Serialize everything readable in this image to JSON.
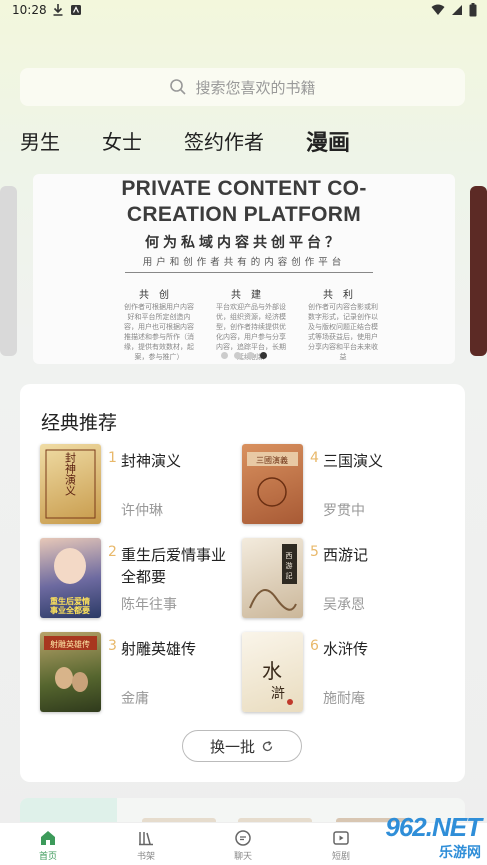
{
  "status_bar": {
    "time": "10:28"
  },
  "search": {
    "placeholder": "搜索您喜欢的书籍"
  },
  "tabs": [
    {
      "label": "男生",
      "active": false
    },
    {
      "label": "女士",
      "active": false
    },
    {
      "label": "签约作者",
      "active": false
    },
    {
      "label": "漫画",
      "active": true
    }
  ],
  "banner": {
    "title_line1": "PRIVATE CONTENT CO-",
    "title_line2": "CREATION PLATFORM",
    "headline": "何为私域内容共创平台？",
    "subline": "用户和创作者共有的内容创作平台",
    "columns": [
      {
        "head": "共创",
        "text": "创作者可根据用户内容好和平台所定创造内容，用户也可根据内容推描述和参与所作（消缘，提供有效数材，起案，参与推广）"
      },
      {
        "head": "共建",
        "text": "平台欢迎产品与外部设优，组织资源，经济模型，创作者持续提供优化内容，用户参与分享内容，追踪平台，长期延续创新"
      },
      {
        "head": "共利",
        "text": "创作者可内容合影或利数字形式，记录创作以及与版权问题正结合模式等场获益后，使用户分享内容和平台未来收益"
      }
    ],
    "dots": 4,
    "active_dot": 3
  },
  "recommend": {
    "title": "经典推荐",
    "books": [
      {
        "rank": "1",
        "title": "封神演义",
        "author": "许仲琳",
        "cover_text": "封神演义",
        "cover_color": "#e3c98a"
      },
      {
        "rank": "4",
        "title": "三国演义",
        "author": "罗贯中",
        "cover_text": "三國演義",
        "cover_color": "#c87a4e"
      },
      {
        "rank": "2",
        "title": "重生后爱情事业全都要",
        "author": "陈年往事",
        "cover_text": "重生后爱情事业全都要",
        "cover_color": "#3a4f7a"
      },
      {
        "rank": "5",
        "title": "西游记",
        "author": "吴承恩",
        "cover_text": "西游記",
        "cover_color": "#e9dfcf"
      },
      {
        "rank": "3",
        "title": "射雕英雄传",
        "author": "金庸",
        "cover_text": "射雕英雄传",
        "cover_color": "#6b7a3e"
      },
      {
        "rank": "6",
        "title": "水浒传",
        "author": "施耐庵",
        "cover_text": "水滸",
        "cover_color": "#f1ead9"
      }
    ],
    "refresh_label": "换一批"
  },
  "bottom_nav": [
    {
      "label": "首页",
      "icon": "home-icon",
      "active": true
    },
    {
      "label": "书架",
      "icon": "bookshelf-icon",
      "active": false
    },
    {
      "label": "聊天",
      "icon": "chat-icon",
      "active": false
    },
    {
      "label": "短剧",
      "icon": "video-icon",
      "active": false
    }
  ],
  "watermark": {
    "big": "962.NET",
    "small": "乐游网"
  },
  "colors": {
    "accent": "#3c9a5a",
    "rank": "#e8b86a",
    "muted": "#999999"
  }
}
